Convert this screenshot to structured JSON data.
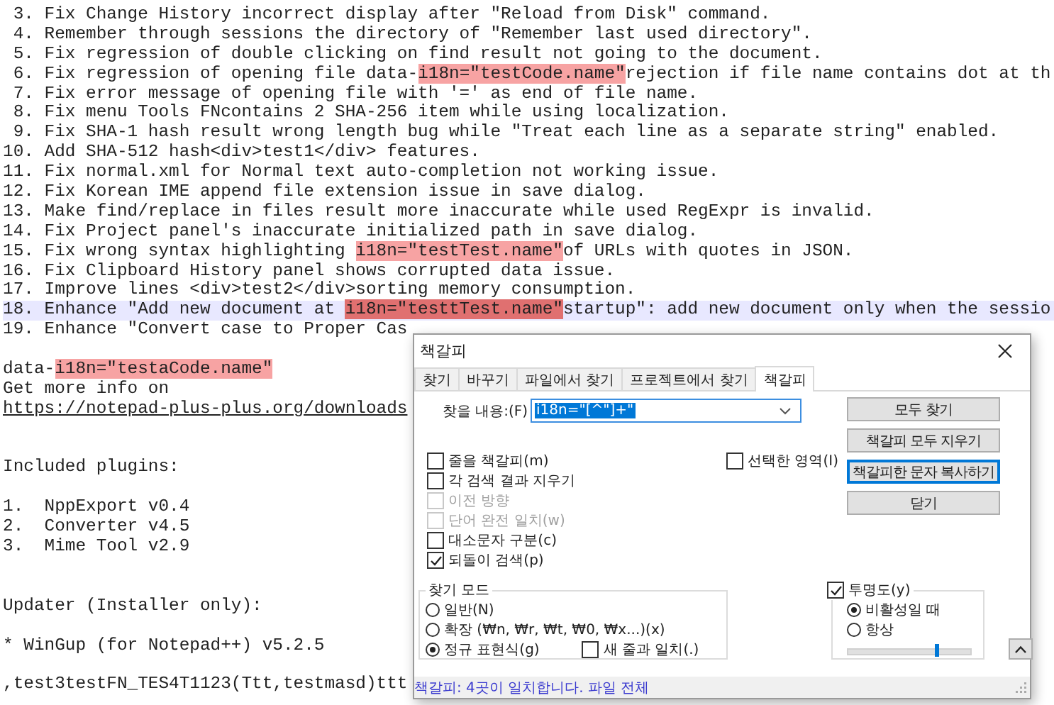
{
  "editor": {
    "lines": [
      {
        "current": false,
        "parts": [
          {
            "kind": "text",
            "text": " 3. Fix Change History incorrect display after \"Reload from Disk\" command."
          }
        ]
      },
      {
        "current": false,
        "parts": [
          {
            "kind": "text",
            "text": " 4. Remember through sessions the directory of \"Remember last used directory\"."
          }
        ]
      },
      {
        "current": false,
        "parts": [
          {
            "kind": "text",
            "text": " 5. Fix regression of double clicking on find result not going to the document."
          }
        ]
      },
      {
        "current": false,
        "parts": [
          {
            "kind": "text",
            "text": " 6. Fix regression of opening file data-"
          },
          {
            "kind": "match",
            "text": "i18n=\"testCode.name\""
          },
          {
            "kind": "text",
            "text": "rejection if file name contains dot at th"
          }
        ]
      },
      {
        "current": false,
        "parts": [
          {
            "kind": "text",
            "text": " 7. Fix error message of opening file with '=' as end of file name."
          }
        ]
      },
      {
        "current": false,
        "parts": [
          {
            "kind": "text",
            "text": " 8. Fix menu Tools FNcontains 2 SHA-256 item while using localization."
          }
        ]
      },
      {
        "current": false,
        "parts": [
          {
            "kind": "text",
            "text": " 9. Fix SHA-1 hash result wrong length bug while \"Treat each line as a separate string\" enabled."
          }
        ]
      },
      {
        "current": false,
        "parts": [
          {
            "kind": "text",
            "text": "10. Add SHA-512 hash<div>test1</div> features."
          }
        ]
      },
      {
        "current": false,
        "parts": [
          {
            "kind": "text",
            "text": "11. Fix normal.xml for Normal text auto-completion not working issue."
          }
        ]
      },
      {
        "current": false,
        "parts": [
          {
            "kind": "text",
            "text": "12. Fix Korean IME append file extension issue in save dialog."
          }
        ]
      },
      {
        "current": false,
        "parts": [
          {
            "kind": "text",
            "text": "13. Make find/replace in files result more inaccurate while used RegExpr is invalid."
          }
        ]
      },
      {
        "current": false,
        "parts": [
          {
            "kind": "text",
            "text": "14. Fix Project panel's inaccurate initialized path in save dialog."
          }
        ]
      },
      {
        "current": false,
        "parts": [
          {
            "kind": "text",
            "text": "15. Fix wrong syntax highlighting "
          },
          {
            "kind": "match",
            "text": "i18n=\"testTest.name\""
          },
          {
            "kind": "text",
            "text": "of URLs with quotes in JSON."
          }
        ]
      },
      {
        "current": false,
        "parts": [
          {
            "kind": "text",
            "text": "16. Fix Clipboard History panel shows corrupted data issue."
          }
        ]
      },
      {
        "current": false,
        "parts": [
          {
            "kind": "text",
            "text": "17. Improve lines <div>test2</div>sorting memory consumption."
          }
        ]
      },
      {
        "current": true,
        "parts": [
          {
            "kind": "text",
            "text": "18. Enhance \"Add new document at "
          },
          {
            "kind": "match-current",
            "text": "i18n=\"testtTest.name\""
          },
          {
            "kind": "text",
            "text": "startup\": add new document only when the sessio"
          }
        ]
      },
      {
        "current": false,
        "parts": [
          {
            "kind": "text",
            "text": "19. Enhance \"Convert case to Proper Cas"
          }
        ]
      },
      {
        "current": false
      },
      {
        "current": false,
        "parts": [
          {
            "kind": "text",
            "text": "data-"
          },
          {
            "kind": "match",
            "text": "i18n=\"testaCode.name\""
          }
        ]
      },
      {
        "current": false,
        "parts": [
          {
            "kind": "text",
            "text": "Get more info on"
          }
        ]
      },
      {
        "current": false,
        "parts": [
          {
            "kind": "link",
            "text": "https://notepad-plus-plus.org/downloads"
          }
        ]
      },
      {
        "current": false
      },
      {
        "current": false
      },
      {
        "current": false,
        "parts": [
          {
            "kind": "text",
            "text": "Included plugins:"
          }
        ]
      },
      {
        "current": false
      },
      {
        "current": false,
        "parts": [
          {
            "kind": "text",
            "text": "1.  NppExport v0.4"
          }
        ]
      },
      {
        "current": false,
        "parts": [
          {
            "kind": "text",
            "text": "2.  Converter v4.5"
          }
        ]
      },
      {
        "current": false,
        "parts": [
          {
            "kind": "text",
            "text": "3.  Mime Tool v2.9"
          }
        ]
      },
      {
        "current": false
      },
      {
        "current": false
      },
      {
        "current": false,
        "parts": [
          {
            "kind": "text",
            "text": "Updater (Installer only):"
          }
        ]
      },
      {
        "current": false
      },
      {
        "current": false,
        "parts": [
          {
            "kind": "text",
            "text": "* WinGup (for Notepad++) v5.2.5"
          }
        ]
      },
      {
        "current": false
      },
      {
        "current": false,
        "parts": [
          {
            "kind": "text",
            "text": ",test3testFN_TES4T1123(Ttt,testmasd)ttt"
          }
        ]
      }
    ]
  },
  "dialog": {
    "title": "책갈피",
    "tabs": [
      {
        "label": "찾기",
        "selected": false
      },
      {
        "label": "바꾸기",
        "selected": false
      },
      {
        "label": "파일에서 찾기",
        "selected": false
      },
      {
        "label": "프로젝트에서 찾기",
        "selected": false
      },
      {
        "label": "책갈피",
        "selected": true
      }
    ],
    "find": {
      "label": "찾을 내용:(F)",
      "value": "i18n=\"[^\"]+\"",
      "highlighted": true
    },
    "options": [
      {
        "label": "줄을 책갈피(m)",
        "checked": false,
        "disabled": false
      },
      {
        "label": "각 검색 결과 지우기",
        "checked": false,
        "disabled": false
      },
      {
        "label": "이전 방향",
        "checked": false,
        "disabled": true
      },
      {
        "label": "단어 완전 일치(w)",
        "checked": false,
        "disabled": true
      },
      {
        "label": "대소문자 구분(c)",
        "checked": false,
        "disabled": false
      },
      {
        "label": "되돌이 검색(p)",
        "checked": true,
        "disabled": false
      }
    ],
    "in_selection": {
      "label": "선택한 영역(I)",
      "checked": false
    },
    "buttons": [
      {
        "label": "모두 찾기",
        "focused": false
      },
      {
        "label": "책갈피 모두 지우기",
        "focused": false
      },
      {
        "label": "책갈피한 문자 복사하기",
        "focused": true
      },
      {
        "label": "닫기",
        "focused": false
      }
    ],
    "search_mode": {
      "title": "찾기 모드",
      "options": [
        {
          "label": "일반(N)",
          "selected": false
        },
        {
          "label": "확장 (₩n, ₩r, ₩t, ₩0, ₩x...)(x)",
          "selected": false
        },
        {
          "label": "정규 표현식(g)",
          "selected": true
        }
      ],
      "match_newline": {
        "label": "새 줄과 일치(.)",
        "checked": false
      }
    },
    "transparency": {
      "label": "투명도(y)",
      "checked": true,
      "options": [
        {
          "label": "비활성일 때",
          "selected": true
        },
        {
          "label": "항상",
          "selected": false
        }
      ],
      "level": 0.72
    },
    "status": "책갈피: 4곳이 일치합니다. 파일 전체"
  }
}
